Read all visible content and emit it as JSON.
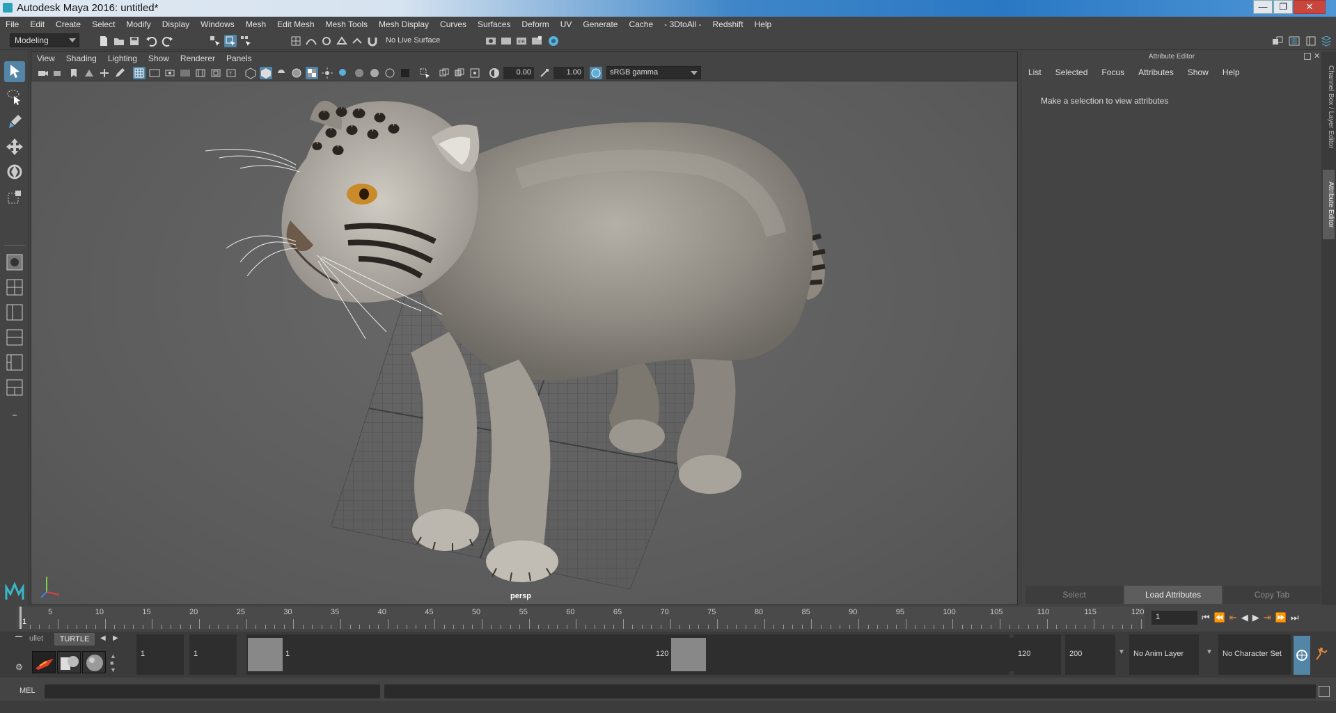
{
  "window": {
    "title": "Autodesk Maya 2016: untitled*",
    "controls": [
      "—",
      "❐",
      "✕"
    ]
  },
  "menubar": [
    "File",
    "Edit",
    "Create",
    "Select",
    "Modify",
    "Display",
    "Windows",
    "Mesh",
    "Edit Mesh",
    "Mesh Tools",
    "Mesh Display",
    "Curves",
    "Surfaces",
    "Deform",
    "UV",
    "Generate",
    "Cache",
    "- 3DtoAll -",
    "Redshift",
    "Help"
  ],
  "toolbar": {
    "mode": "Modeling",
    "live_surface": "No Live Surface"
  },
  "viewport": {
    "menu": [
      "View",
      "Shading",
      "Lighting",
      "Show",
      "Renderer",
      "Panels"
    ],
    "exposure": "0.00",
    "gamma": "1.00",
    "color_space": "sRGB gamma",
    "camera_label": "persp"
  },
  "attribute_editor": {
    "header": "Attribute Editor",
    "menu": [
      "List",
      "Selected",
      "Focus",
      "Attributes",
      "Show",
      "Help"
    ],
    "message": "Make a selection to view attributes",
    "buttons": {
      "select": "Select",
      "load": "Load Attributes",
      "copy_tab": "Copy Tab"
    }
  },
  "side_tabs": {
    "channel_box": "Channel Box / Layer Editor",
    "attribute_editor": "Attribute Editor"
  },
  "timeline": {
    "labels": [
      "1",
      "5",
      "10",
      "15",
      "20",
      "25",
      "30",
      "35",
      "40",
      "45",
      "50",
      "55",
      "60",
      "65",
      "70",
      "75",
      "80",
      "85",
      "90",
      "95",
      "100",
      "105",
      "110",
      "115",
      "120"
    ],
    "current_frame": "1"
  },
  "range": {
    "shelf_tab_prev": "ullet",
    "shelf_tab": "TURTLE",
    "start": "1",
    "playback_start": "1",
    "range_start_label": "1",
    "range_end_label": "120",
    "playback_end": "120",
    "end": "200",
    "anim_layer": "No Anim Layer",
    "character_set": "No Character Set"
  },
  "command": {
    "label": "MEL"
  }
}
